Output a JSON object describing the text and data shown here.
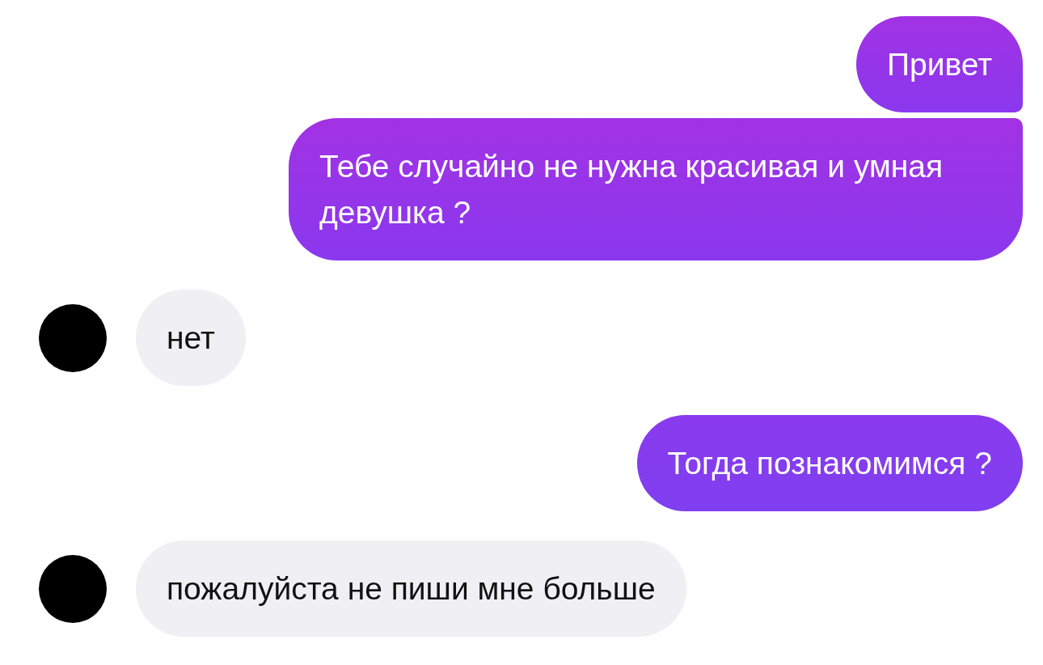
{
  "messages": [
    {
      "kind": "sent",
      "text": "Привет"
    },
    {
      "kind": "sent",
      "text": "Тебе случайно не нужна красивая и умная девушка ?"
    },
    {
      "kind": "received",
      "text": "нет"
    },
    {
      "kind": "sent",
      "text": "Тогда познакомимся ?"
    },
    {
      "kind": "received",
      "text": "пожалуйста не пиши мне больше"
    }
  ]
}
